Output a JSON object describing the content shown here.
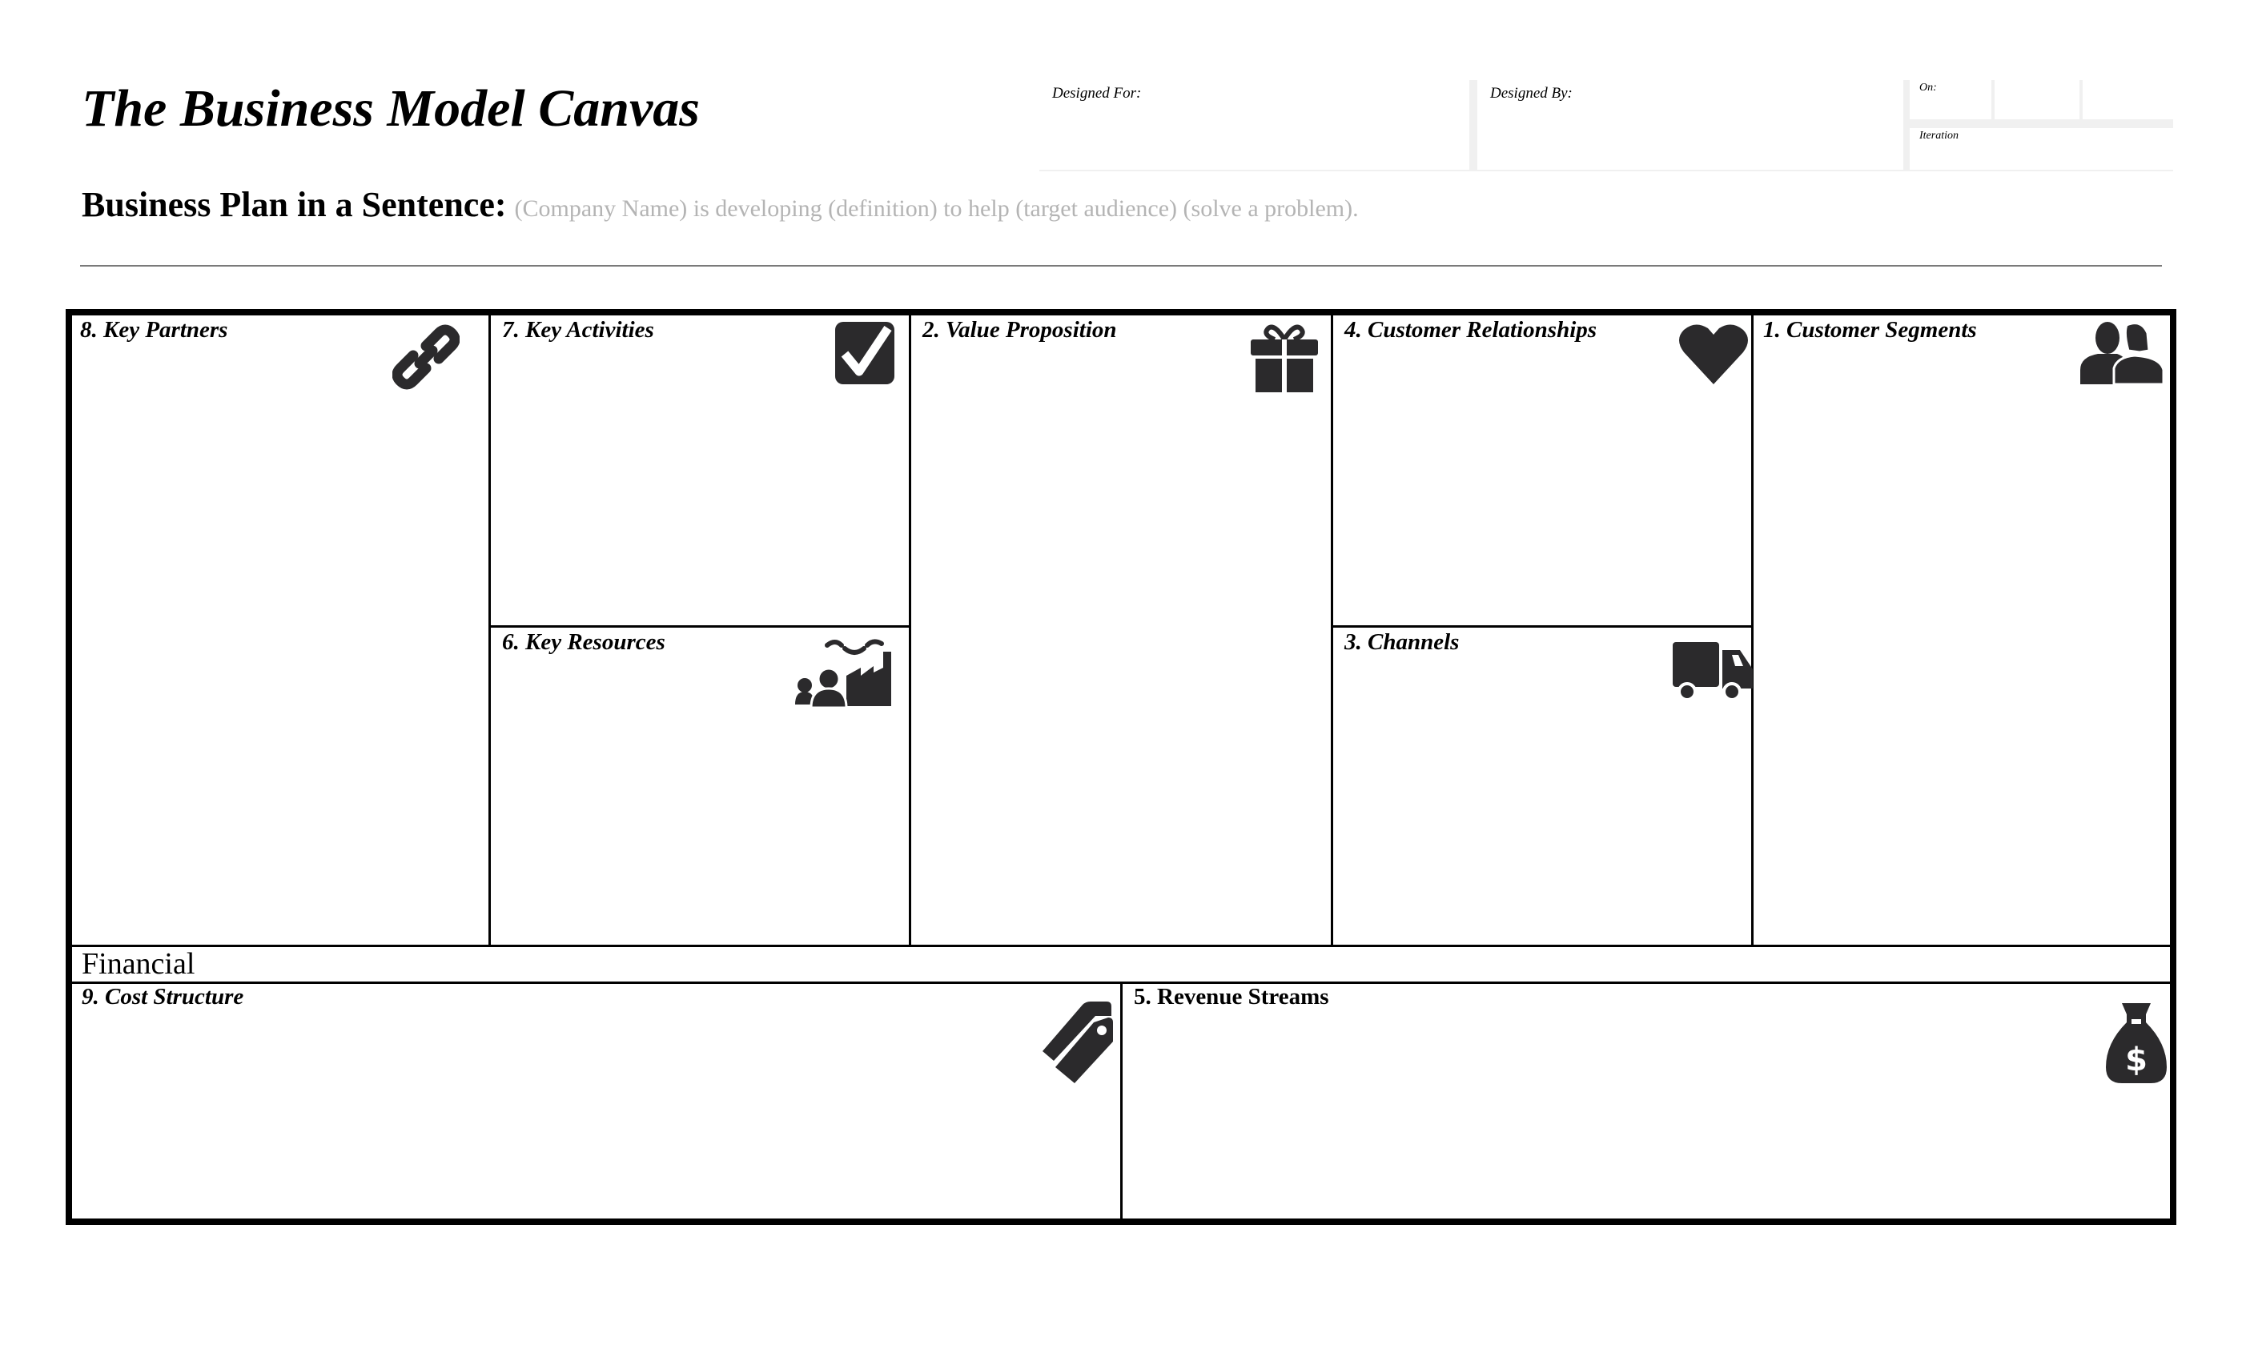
{
  "header": {
    "title": "The Business Model Canvas",
    "sentence_label": "Business Plan in a Sentence:",
    "sentence_placeholder": "(Company Name) is developing (definition) to help (target audience) (solve a problem)."
  },
  "meta": {
    "designed_for_label": "Designed For:",
    "designed_by_label": "Designed By:",
    "on_label": "On:",
    "iteration_label": "Iteration"
  },
  "canvas": {
    "blocks": [
      {
        "label": "8. Key Partners",
        "icon": "link-icon"
      },
      {
        "label": "7. Key Activities",
        "icon": "checkbox-icon"
      },
      {
        "label": "6. Key Resources",
        "icon": "factory-people-icon"
      },
      {
        "label": "2. Value Proposition",
        "icon": "gift-icon"
      },
      {
        "label": "4. Customer Relationships",
        "icon": "heart-icon"
      },
      {
        "label": "3. Channels",
        "icon": "truck-icon"
      },
      {
        "label": "1. Customer Segments",
        "icon": "people-icon"
      }
    ],
    "financial_label": "Financial",
    "cost_structure_label": "9. Cost Structure",
    "revenue_streams_label": "5. Revenue Streams",
    "icon_color": "#2b2a2c"
  }
}
